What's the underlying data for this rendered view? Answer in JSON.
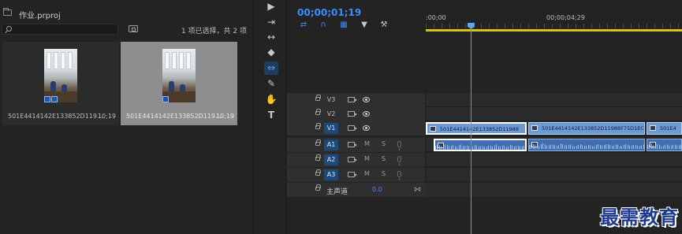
{
  "project": {
    "title": "作业.prproj",
    "search_placeholder": "",
    "selection_status": "1 项已选择，共 2 项",
    "items": [
      {
        "name": "501E4414142E133852D119...",
        "duration": "10;19",
        "selected": false
      },
      {
        "name": "501E4414142E133852D119...",
        "duration": "10;19",
        "selected": true
      }
    ]
  },
  "tools": [
    "selection",
    "track-select",
    "ripple-edit",
    "razor",
    "slip",
    "pen",
    "hand",
    "type"
  ],
  "sequence": {
    "timecode": "00;00;01;19",
    "ruler": {
      "start_label": ":00;00",
      "mid_label": "00;00;04;29"
    },
    "tracks": [
      {
        "id": "V3",
        "type": "video",
        "targeted": false
      },
      {
        "id": "V2",
        "type": "video",
        "targeted": false
      },
      {
        "id": "V1",
        "type": "video",
        "targeted": true
      },
      {
        "id": "A1",
        "type": "audio",
        "targeted": true,
        "mute": "M",
        "solo": "S"
      },
      {
        "id": "A2",
        "type": "audio",
        "targeted": true,
        "mute": "M",
        "solo": "S"
      },
      {
        "id": "A3",
        "type": "audio",
        "targeted": true,
        "mute": "M",
        "solo": "S"
      }
    ],
    "master": {
      "label": "主声道",
      "value": "0.0"
    },
    "video_clips": [
      {
        "label": "501E4414142E133852D11988",
        "selected": true
      },
      {
        "label": "501E4414142E133852D11988F75D1EC",
        "selected": false
      },
      {
        "label": "501E4",
        "selected": false
      }
    ]
  },
  "watermark": "最需教育",
  "colors": {
    "accent": "#3a8dff",
    "workarea": "#d3c320",
    "clip_video": "#6e9ad4",
    "clip_audio": "#3f6fb0"
  }
}
